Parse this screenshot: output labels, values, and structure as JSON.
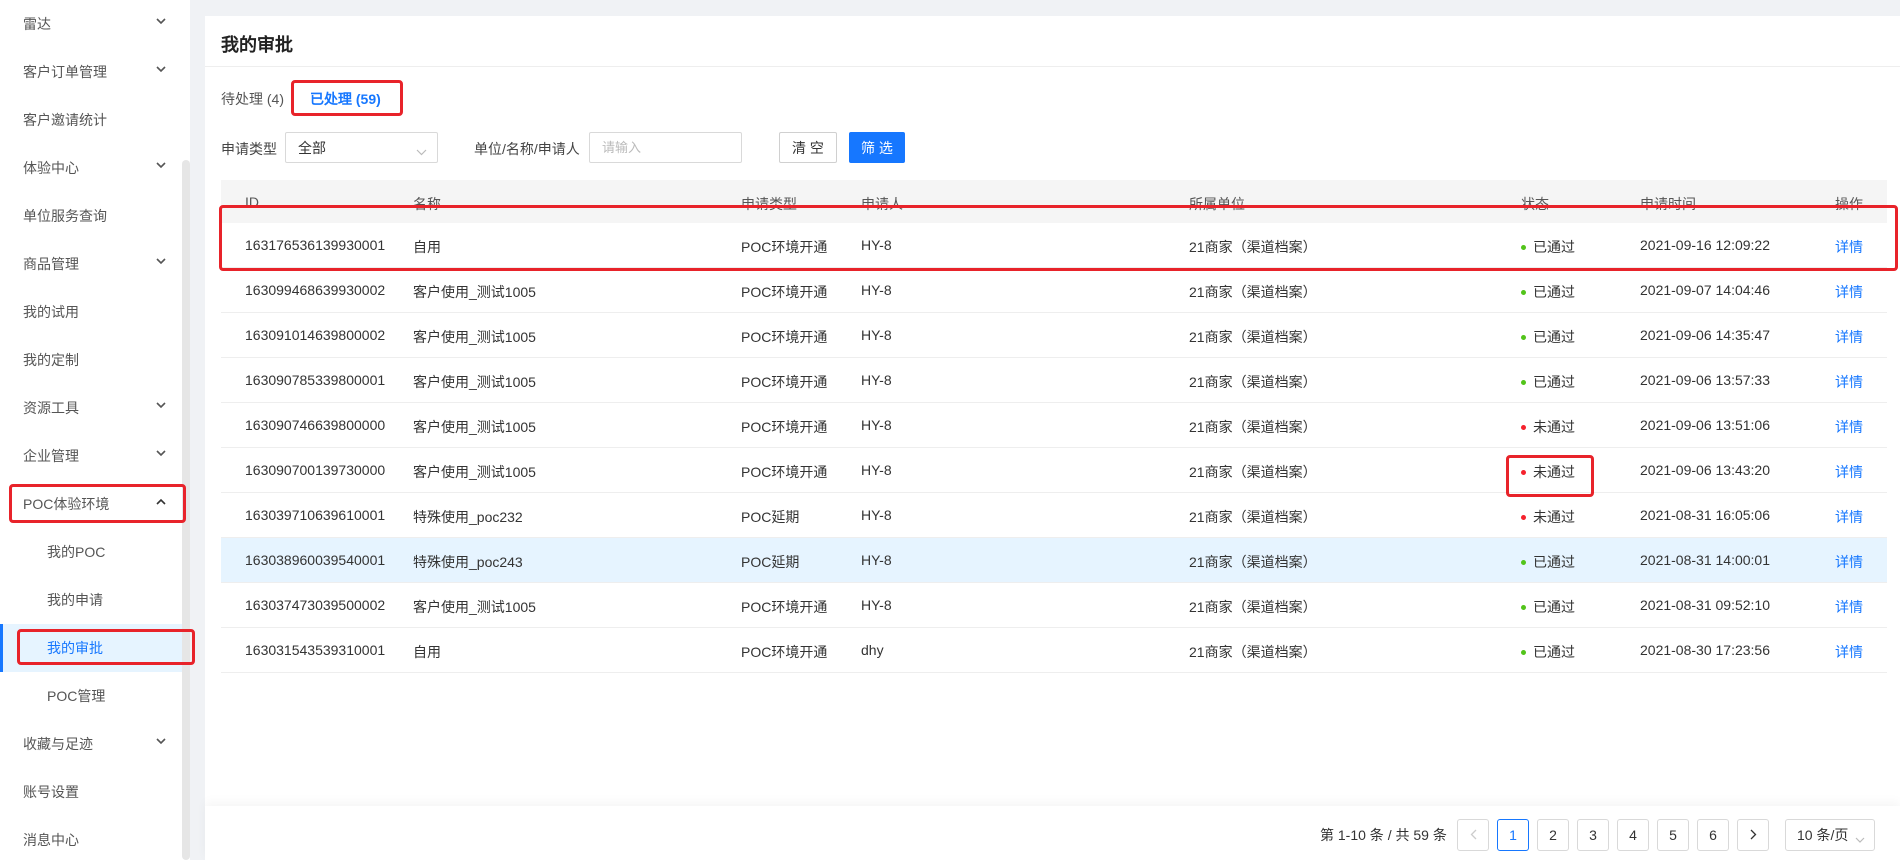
{
  "sidebar": {
    "items": [
      {
        "label": "雷达",
        "has_children": true
      },
      {
        "label": "客户订单管理",
        "has_children": true
      },
      {
        "label": "客户邀请统计",
        "has_children": false
      },
      {
        "label": "体验中心",
        "has_children": true
      },
      {
        "label": "单位服务查询",
        "has_children": false
      },
      {
        "label": "商品管理",
        "has_children": true
      },
      {
        "label": "我的试用",
        "has_children": false
      },
      {
        "label": "我的定制",
        "has_children": false
      },
      {
        "label": "资源工具",
        "has_children": true
      },
      {
        "label": "企业管理",
        "has_children": true
      },
      {
        "label": "POC体验环境",
        "has_children": true,
        "expanded": true
      },
      {
        "label": "我的POC",
        "sub": true
      },
      {
        "label": "我的申请",
        "sub": true
      },
      {
        "label": "我的审批",
        "sub": true,
        "selected": true
      },
      {
        "label": "POC管理",
        "sub": true
      },
      {
        "label": "收藏与足迹",
        "has_children": true
      },
      {
        "label": "账号设置",
        "has_children": false
      },
      {
        "label": "消息中心",
        "has_children": false
      }
    ]
  },
  "page": {
    "title": "我的审批"
  },
  "tabs": {
    "pending": "待处理 (4)",
    "done": "已处理 (59)"
  },
  "filters": {
    "type_label": "申请类型",
    "type_value": "全部",
    "search_label": "单位/名称/申请人",
    "search_placeholder": "请输入",
    "clear_label": "清 空",
    "filter_label": "筛 选"
  },
  "table": {
    "headers": [
      "ID",
      "名称",
      "申请类型",
      "申请人",
      "所属单位",
      "状态",
      "申请时间",
      "操作"
    ],
    "rows": [
      {
        "id": "163176536139930001",
        "name": "自用",
        "type": "POC环境开通",
        "applicant": "HY-8",
        "unit": "21商家（渠道档案）",
        "status": "已通过",
        "time": "2021-09-16 12:09:22",
        "action": "详情"
      },
      {
        "id": "163099468639930002",
        "name": "客户使用_测试1005",
        "type": "POC环境开通",
        "applicant": "HY-8",
        "unit": "21商家（渠道档案）",
        "status": "已通过",
        "time": "2021-09-07 14:04:46",
        "action": "详情"
      },
      {
        "id": "163091014639800002",
        "name": "客户使用_测试1005",
        "type": "POC环境开通",
        "applicant": "HY-8",
        "unit": "21商家（渠道档案）",
        "status": "已通过",
        "time": "2021-09-06 14:35:47",
        "action": "详情"
      },
      {
        "id": "163090785339800001",
        "name": "客户使用_测试1005",
        "type": "POC环境开通",
        "applicant": "HY-8",
        "unit": "21商家（渠道档案）",
        "status": "已通过",
        "time": "2021-09-06 13:57:33",
        "action": "详情"
      },
      {
        "id": "163090746639800000",
        "name": "客户使用_测试1005",
        "type": "POC环境开通",
        "applicant": "HY-8",
        "unit": "21商家（渠道档案）",
        "status": "未通过",
        "time": "2021-09-06 13:51:06",
        "action": "详情"
      },
      {
        "id": "163090700139730000",
        "name": "客户使用_测试1005",
        "type": "POC环境开通",
        "applicant": "HY-8",
        "unit": "21商家（渠道档案）",
        "status": "未通过",
        "time": "2021-09-06 13:43:20",
        "action": "详情"
      },
      {
        "id": "163039710639610001",
        "name": "特殊使用_poc232",
        "type": "POC延期",
        "applicant": "HY-8",
        "unit": "21商家（渠道档案）",
        "status": "未通过",
        "time": "2021-08-31 16:05:06",
        "action": "详情"
      },
      {
        "id": "163038960039540001",
        "name": "特殊使用_poc243",
        "type": "POC延期",
        "applicant": "HY-8",
        "unit": "21商家（渠道档案）",
        "status": "已通过",
        "time": "2021-08-31 14:00:01",
        "action": "详情",
        "highlight": true
      },
      {
        "id": "163037473039500002",
        "name": "客户使用_测试1005",
        "type": "POC环境开通",
        "applicant": "HY-8",
        "unit": "21商家（渠道档案）",
        "status": "已通过",
        "time": "2021-08-31 09:52:10",
        "action": "详情"
      },
      {
        "id": "163031543539310001",
        "name": "自用",
        "type": "POC环境开通",
        "applicant": "dhy",
        "unit": "21商家（渠道档案）",
        "status": "已通过",
        "time": "2021-08-30 17:23:56",
        "action": "详情"
      }
    ]
  },
  "pagination": {
    "total_text": "第 1-10 条 / 共 59 条",
    "pages": [
      "1",
      "2",
      "3",
      "4",
      "5",
      "6"
    ],
    "current": "1",
    "page_size": "10 条/页"
  },
  "colors": {
    "accent": "#1677ff",
    "status_pass": "#52c41a",
    "status_fail": "#f5222d",
    "annotation": "#e8232a"
  }
}
